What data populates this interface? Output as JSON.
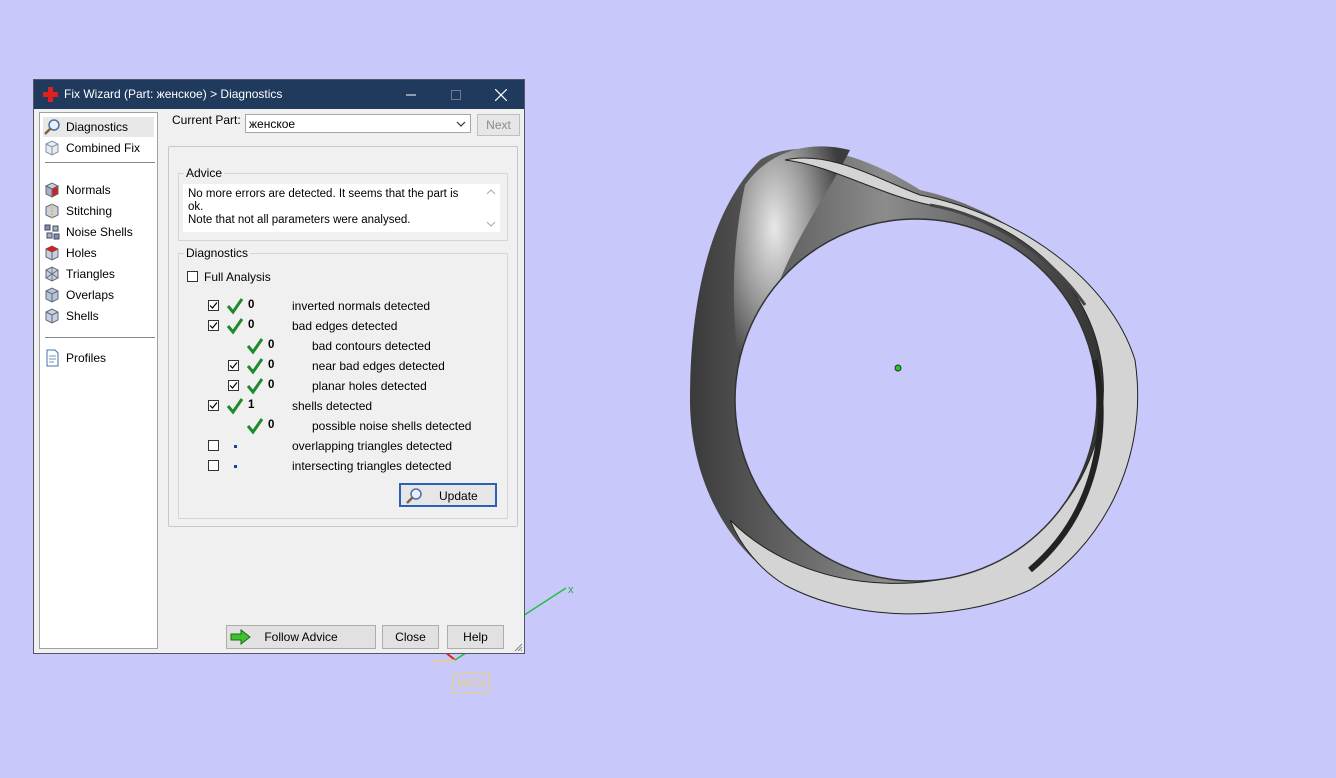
{
  "viewport": {
    "background": "#c8c8fa",
    "wcs_label": "WCS",
    "axis_x_label": "x"
  },
  "dialog": {
    "title": "Fix Wizard (Part: женское) > Diagnostics",
    "title_icon": "red-cross-icon",
    "window_buttons": [
      "minimize",
      "maximize",
      "close"
    ],
    "sidebar": {
      "items": [
        {
          "label": "Diagnostics",
          "icon": "magnifier-icon",
          "selected": true
        },
        {
          "label": "Combined Fix",
          "icon": "cube-wire-icon"
        },
        {
          "label": "Normals",
          "icon": "cube-red-face-icon"
        },
        {
          "label": "Stitching",
          "icon": "cube-stitch-icon"
        },
        {
          "label": "Noise Shells",
          "icon": "noise-dots-icon"
        },
        {
          "label": "Holes",
          "icon": "cube-hole-icon"
        },
        {
          "label": "Triangles",
          "icon": "triangles-icon"
        },
        {
          "label": "Overlaps",
          "icon": "cube-overlap-icon"
        },
        {
          "label": "Shells",
          "icon": "cube-shell-icon"
        },
        {
          "label": "Profiles",
          "icon": "document-icon"
        }
      ]
    },
    "current_part_label": "Current Part:",
    "current_part_value": "женское",
    "next_label": "Next",
    "advice": {
      "title": "Advice",
      "text_line1": "No more errors are detected. It seems that the part is ok.",
      "text_line2": "Note that not all parameters were analysed."
    },
    "diagnostics": {
      "title": "Diagnostics",
      "full_analysis_label": "Full Analysis",
      "full_analysis_checked": false,
      "rows": [
        {
          "checked": true,
          "status": "ok",
          "count": "0",
          "text": "inverted normals detected"
        },
        {
          "checked": true,
          "status": "ok",
          "count": "0",
          "text": "bad edges detected"
        },
        {
          "checkbox": false,
          "status": "ok",
          "count": "0",
          "text": "bad contours detected"
        },
        {
          "checked": true,
          "status": "ok",
          "count": "0",
          "text": "near bad edges detected"
        },
        {
          "checked": true,
          "status": "ok",
          "count": "0",
          "text": "planar holes detected"
        },
        {
          "checked": true,
          "status": "ok",
          "count": "1",
          "text": "shells detected"
        },
        {
          "checkbox": false,
          "status": "ok",
          "count": "0",
          "text": "possible noise shells detected"
        },
        {
          "checked": false,
          "status": "pending",
          "count": "",
          "text": "overlapping triangles detected"
        },
        {
          "checked": false,
          "status": "pending",
          "count": "",
          "text": "intersecting triangles detected"
        }
      ]
    },
    "update_label": "Update",
    "follow_advice_label": "Follow Advice",
    "close_label": "Close",
    "help_label": "Help"
  }
}
